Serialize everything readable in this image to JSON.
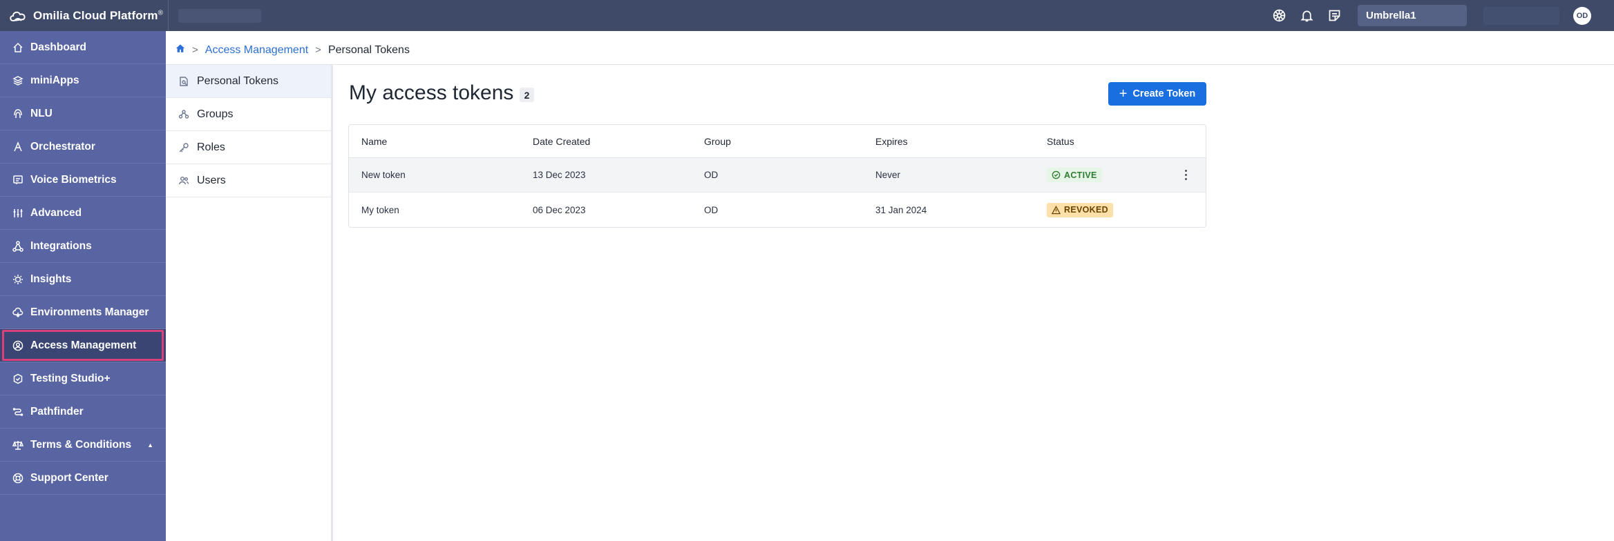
{
  "app": {
    "title": "Omilia Cloud Platform",
    "title_mark": "®"
  },
  "topbar": {
    "org": "Umbrella1",
    "avatar": "OD",
    "icons": [
      "settings-icon",
      "bell-icon",
      "notes-icon"
    ]
  },
  "sidebar": {
    "items": [
      {
        "label": "Dashboard",
        "icon": "home-icon"
      },
      {
        "label": "miniApps",
        "icon": "layers-icon"
      },
      {
        "label": "NLU",
        "icon": "fingerprint-icon"
      },
      {
        "label": "Orchestrator",
        "icon": "compass-icon"
      },
      {
        "label": "Voice Biometrics",
        "icon": "voice-id-icon"
      },
      {
        "label": "Advanced",
        "icon": "sliders-icon"
      },
      {
        "label": "Integrations",
        "icon": "network-icon"
      },
      {
        "label": "Insights",
        "icon": "lightbulb-icon"
      },
      {
        "label": "Environments Manager",
        "icon": "cloud-icon"
      },
      {
        "label": "Access Management",
        "icon": "user-circle-icon",
        "active": true
      },
      {
        "label": "Testing Studio+",
        "icon": "shield-icon"
      },
      {
        "label": "Pathfinder",
        "icon": "route-icon"
      },
      {
        "label": "Terms & Conditions",
        "icon": "scales-icon",
        "caret": "▲"
      },
      {
        "label": "Support Center",
        "icon": "lifebuoy-icon"
      }
    ]
  },
  "breadcrumb": {
    "parent": "Access Management",
    "current": "Personal Tokens",
    "separator": ">"
  },
  "subnav": {
    "items": [
      {
        "label": "Personal Tokens",
        "icon": "token-icon",
        "active": true
      },
      {
        "label": "Groups",
        "icon": "groups-icon"
      },
      {
        "label": "Roles",
        "icon": "key-icon"
      },
      {
        "label": "Users",
        "icon": "users-icon"
      }
    ]
  },
  "main": {
    "title": "My access tokens",
    "count": "2",
    "create_label": "Create Token",
    "table": {
      "columns": [
        "Name",
        "Date Created",
        "Group",
        "Expires",
        "Status"
      ],
      "rows": [
        {
          "name": "New token",
          "created": "13 Dec 2023",
          "group": "OD",
          "expires": "Never",
          "status": "ACTIVE"
        },
        {
          "name": "My token",
          "created": "06 Dec 2023",
          "group": "OD",
          "expires": "31 Jan 2024",
          "status": "REVOKED"
        }
      ]
    }
  },
  "colors": {
    "topbar": "#3f4a69",
    "sidebar": "#5865a2",
    "sidebar_active": "#3a4573",
    "highlight": "#d8417a",
    "primary": "#1a6fe0",
    "active_badge": "#e7f5e8",
    "revoked_badge": "#ffe0a8"
  }
}
